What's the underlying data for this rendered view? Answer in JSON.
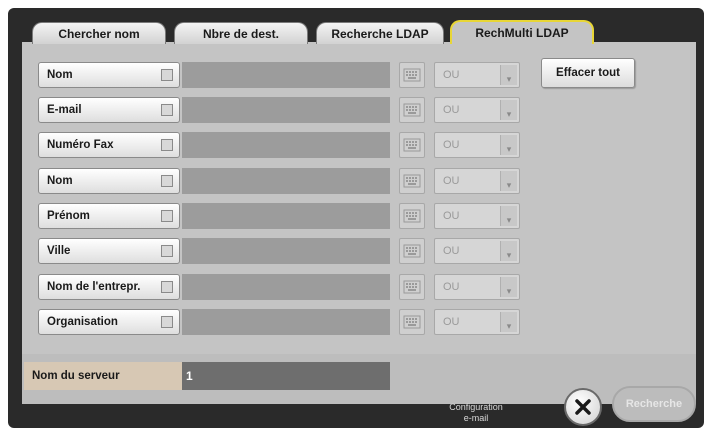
{
  "tabs": [
    {
      "label": "Chercher nom",
      "active": false
    },
    {
      "label": "Nbre de dest.",
      "active": false
    },
    {
      "label": "Recherche LDAP",
      "active": false
    },
    {
      "label": "RechMulti LDAP",
      "active": true
    }
  ],
  "rows": [
    {
      "label": "Nom",
      "value": "",
      "operator": "OU"
    },
    {
      "label": "E-mail",
      "value": "",
      "operator": "OU"
    },
    {
      "label": "Numéro Fax",
      "value": "",
      "operator": "OU"
    },
    {
      "label": "Nom",
      "value": "",
      "operator": "OU"
    },
    {
      "label": "Prénom",
      "value": "",
      "operator": "OU"
    },
    {
      "label": "Ville",
      "value": "",
      "operator": "OU"
    },
    {
      "label": "Nom de l'entrepr.",
      "value": "",
      "operator": "OU"
    },
    {
      "label": "Organisation",
      "value": "",
      "operator": "OU"
    }
  ],
  "clear_all_label": "Effacer tout",
  "server": {
    "label": "Nom du serveur",
    "value": "1"
  },
  "search_label": "Recherche",
  "partial_hidden_label": "e-mail",
  "partial_hidden_label_top": "Configuration"
}
